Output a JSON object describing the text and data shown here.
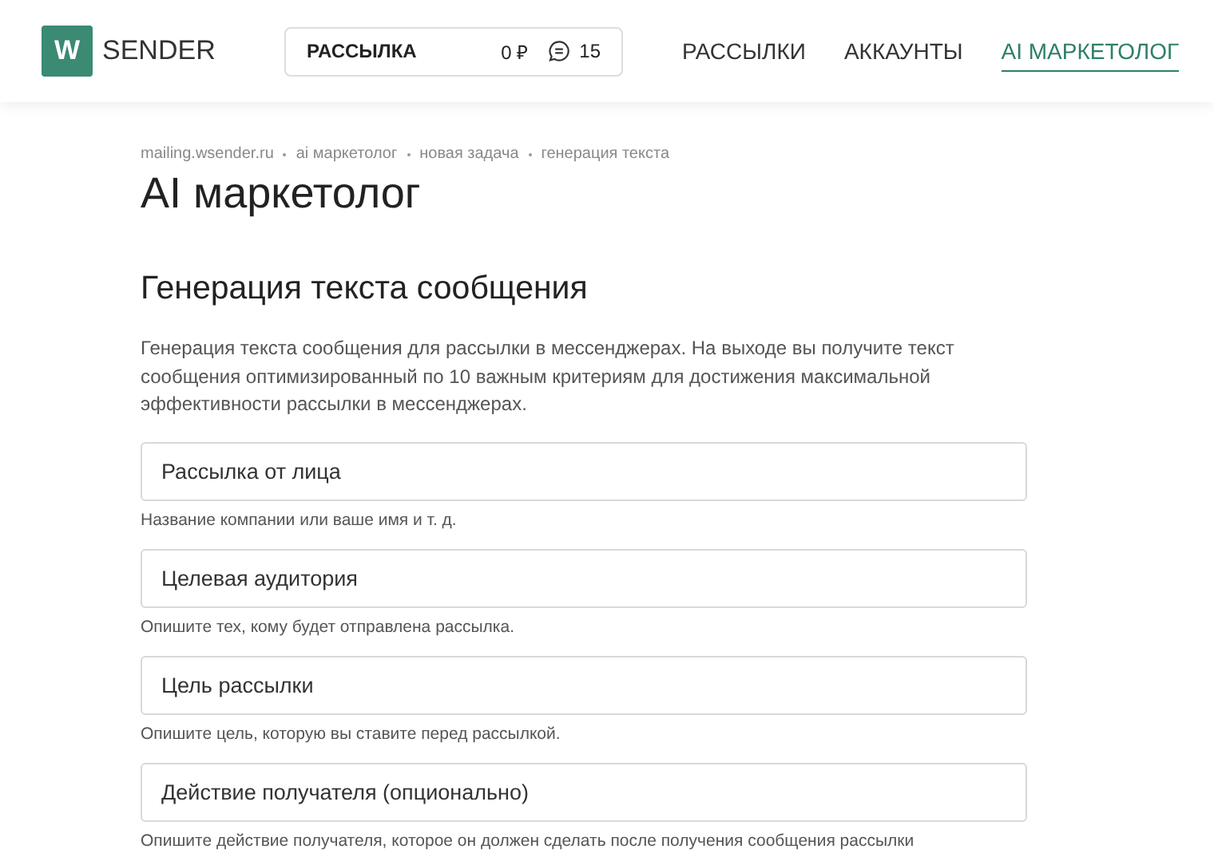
{
  "logo": {
    "mark": "W",
    "name": "SENDER"
  },
  "account_box": {
    "label": "РАССЫЛКА",
    "balance": "0 ₽",
    "messages": "15"
  },
  "nav": [
    {
      "label": "РАССЫЛКИ",
      "selected": false
    },
    {
      "label": "АККАУНТЫ",
      "selected": false
    },
    {
      "label": "AI МАРКЕТОЛОГ",
      "selected": true
    }
  ],
  "breadcrumbs": [
    "mailing.wsender.ru",
    "ai маркетолог",
    "новая задача",
    "генерация текста"
  ],
  "title": "AI маркетолог",
  "section": {
    "title": "Генерация текста сообщения",
    "description": "Генерация текста сообщения для рассылки в мессенджерах. На выходе вы получите текст сообщения оптимизированный по 10 важным критериям для достижения максимальной эффективности рассылки в мессенджерах."
  },
  "fields": [
    {
      "placeholder": "Рассылка от лица",
      "hint": "Название компании или ваше имя и т. д."
    },
    {
      "placeholder": "Целевая аудитория",
      "hint": "Опишите тех, кому будет отправлена рассылка."
    },
    {
      "placeholder": "Цель рассылки",
      "hint": "Опишите цель, которую вы ставите перед рассылкой."
    },
    {
      "placeholder": "Действие получателя (опционально)",
      "hint": "Опишите действие получателя, которое он должен сделать после получения сообщения рассылки"
    }
  ]
}
